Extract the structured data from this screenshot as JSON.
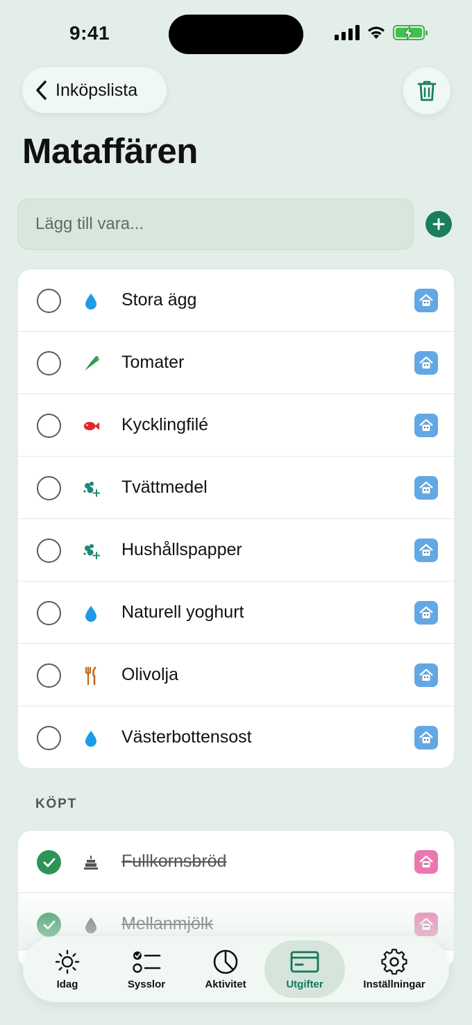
{
  "status": {
    "time": "9:41"
  },
  "header": {
    "back_label": "Inköpslista",
    "title": "Mataffären"
  },
  "add_item": {
    "placeholder": "Lägg till vara..."
  },
  "items": [
    {
      "name": "Stora ägg",
      "icon": "droplet-icon",
      "icon_color": "#1e9be8",
      "owner": "blue"
    },
    {
      "name": "Tomater",
      "icon": "carrot-icon",
      "icon_color": "#2e9a4a",
      "owner": "blue"
    },
    {
      "name": "Kycklingfilé",
      "icon": "fish-icon",
      "icon_color": "#e02a2a",
      "owner": "blue"
    },
    {
      "name": "Tvättmedel",
      "icon": "sparkles-icon",
      "icon_color": "#1a8a7a",
      "owner": "blue"
    },
    {
      "name": "Hushållspapper",
      "icon": "sparkles-icon",
      "icon_color": "#1a8a7a",
      "owner": "blue"
    },
    {
      "name": "Naturell yoghurt",
      "icon": "droplet-icon",
      "icon_color": "#1e9be8",
      "owner": "blue"
    },
    {
      "name": "Olivolja",
      "icon": "fork-knife-icon",
      "icon_color": "#c06a1a",
      "owner": "blue"
    },
    {
      "name": "Västerbottensost",
      "icon": "droplet-icon",
      "icon_color": "#1e9be8",
      "owner": "blue"
    }
  ],
  "bought_section": {
    "label": "KÖPT"
  },
  "bought_items": [
    {
      "name": "Fullkornsbröd",
      "icon": "cake-icon",
      "icon_color": "#555555",
      "owner": "pink"
    },
    {
      "name": "Mellanmjölk",
      "icon": "droplet-icon",
      "icon_color": "#666666",
      "owner": "pink"
    }
  ],
  "tabs": [
    {
      "label": "Idag",
      "icon": "sun-icon",
      "active": false
    },
    {
      "label": "Sysslor",
      "icon": "checklist-icon",
      "active": false
    },
    {
      "label": "Aktivitet",
      "icon": "pie-chart-icon",
      "active": false
    },
    {
      "label": "Utgifter",
      "icon": "credit-card-icon",
      "active": true
    },
    {
      "label": "Inställningar",
      "icon": "gear-icon",
      "active": false
    }
  ],
  "colors": {
    "accent": "#1a7d5e",
    "done_check": "#2e9357",
    "owner_blue": "#63a8e4",
    "owner_pink": "#ea78ae",
    "background": "#e4eee8"
  }
}
